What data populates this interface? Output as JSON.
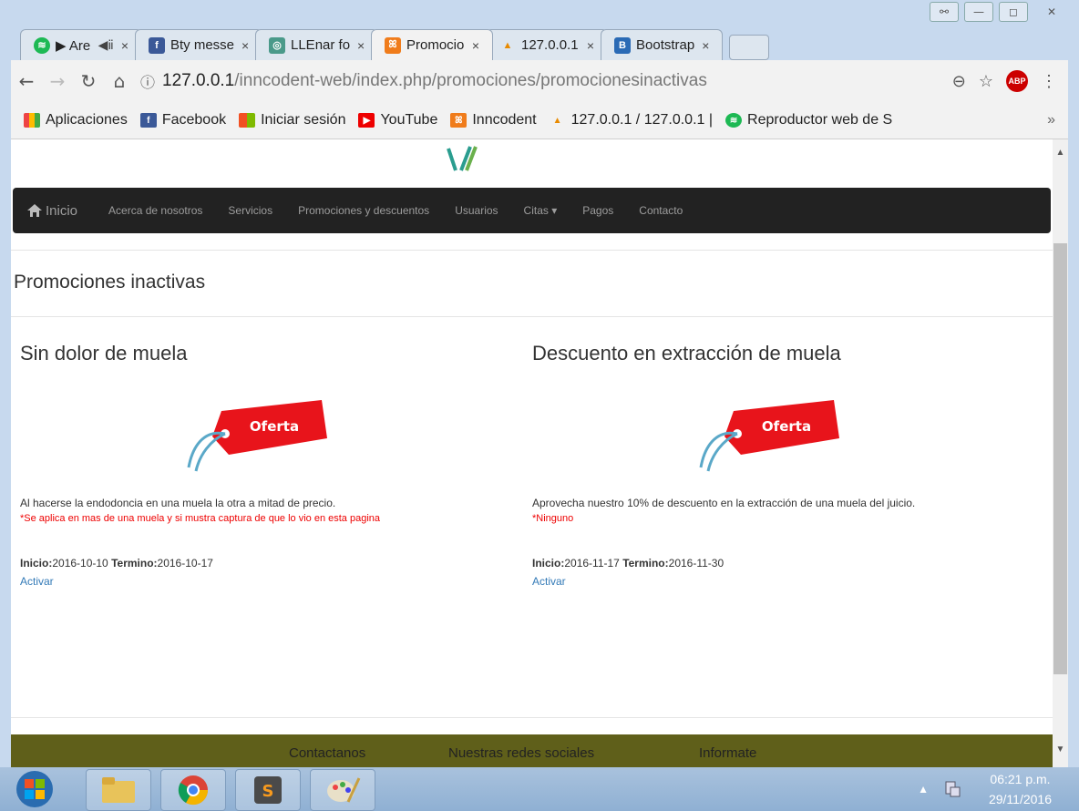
{
  "window": {
    "minimize": "—",
    "maximize": "◻",
    "close": "✕"
  },
  "tabs": [
    {
      "label": "▶ Are",
      "extra": "◀ⅱ",
      "close": "×",
      "icon": "spotify-icon"
    },
    {
      "label": "Bty messe",
      "close": "×",
      "icon": "facebook-icon"
    },
    {
      "label": "LLEnar fo",
      "close": "×",
      "icon": "llenar-icon"
    },
    {
      "label": "Promocio",
      "close": "×",
      "icon": "xampp-icon",
      "active": true
    },
    {
      "label": "127.0.0.1",
      "close": "×",
      "icon": "phpmyadmin-icon"
    },
    {
      "label": "Bootstrap",
      "close": "×",
      "icon": "bootstrap-icon"
    }
  ],
  "toolbar": {
    "url_host": "127.0.0.1",
    "url_path": "/inncodent-web/index.php/promociones/promocionesinactivas",
    "abp": "ABP"
  },
  "bookmarks": [
    "Aplicaciones",
    "Facebook",
    "Iniciar sesión",
    "YouTube",
    "Inncodent",
    "127.0.0.1 / 127.0.0.1 |",
    "Reproductor web de S"
  ],
  "bookmarks_more": "»",
  "navbar": {
    "home": "Inicio",
    "items": [
      "Acerca de nosotros",
      "Servicios",
      "Promociones y descuentos",
      "Usuarios",
      "Citas ▾",
      "Pagos",
      "Contacto"
    ]
  },
  "page_title": "Promociones inactivas",
  "promos": [
    {
      "title": "Sin dolor de muela",
      "tag": "Oferta",
      "description": "Al hacerse la endodoncia en una muela la otra a mitad de precio.",
      "note": "*Se aplica en mas de una muela y si mustra captura de que lo vio en esta pagina",
      "start_label": "Inicio:",
      "start": "2016-10-10",
      "end_label": "Termino:",
      "end": "2016-10-17",
      "action": "Activar"
    },
    {
      "title": "Descuento en extracción de muela",
      "tag": "Oferta",
      "description": "Aprovecha nuestro 10% de descuento en la extracción de una muela del juicio.",
      "note": "*Ninguno",
      "start_label": "Inicio:",
      "start": "2016-11-17",
      "end_label": "Termino:",
      "end": "2016-11-30",
      "action": "Activar"
    }
  ],
  "footer": [
    "Contactanos",
    "Nuestras redes sociales",
    "Informate"
  ],
  "clock": {
    "time": "06:21 p.m.",
    "date": "29/11/2016"
  },
  "colors": {
    "navbar": "#222222",
    "link": "#337ab7",
    "note": "#ee0000",
    "tag": "#e8141b",
    "footer": "#5f5f1a"
  }
}
